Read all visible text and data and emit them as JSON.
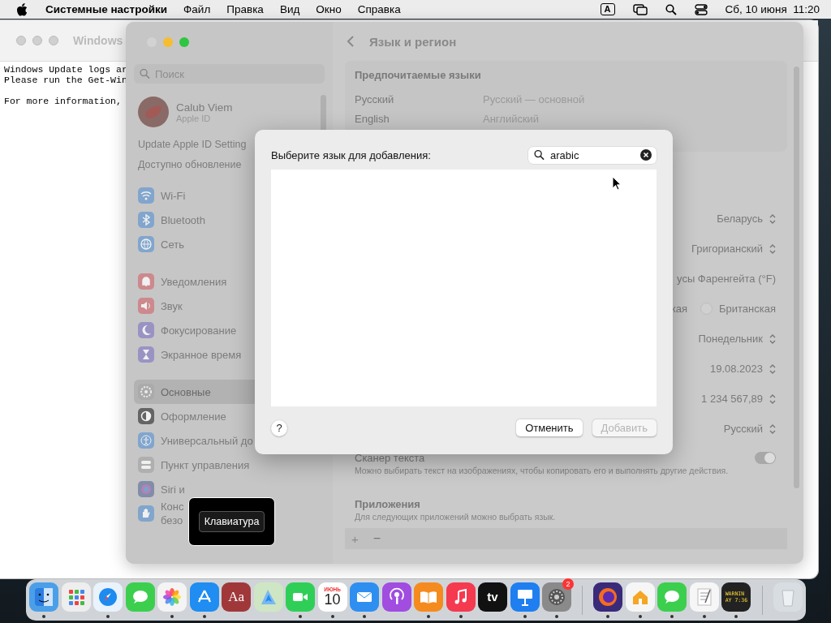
{
  "menu_bar": {
    "app": "Системные настройки",
    "menus": [
      "Файл",
      "Правка",
      "Вид",
      "Окно",
      "Справка"
    ],
    "input_source": "A",
    "clock": "Сб, 10 июня  11:20"
  },
  "terminal": {
    "title": "Windows",
    "paragraphs": [
      [
        "Windows Update logs ar",
        "Please run the Get-Win"
      ],
      [
        "For more information,"
      ]
    ]
  },
  "settings": {
    "title": "Язык и регион",
    "search": {
      "placeholder": "Поиск"
    },
    "account": {
      "name": "Calub Viem",
      "subtitle": "Apple ID"
    },
    "notices": [
      "Update Apple ID Setting",
      "Доступно обновление"
    ],
    "groups": [
      [
        {
          "label": "Wi-Fi",
          "selected": false
        },
        {
          "label": "Bluetooth",
          "selected": false
        },
        {
          "label": "Сеть",
          "selected": false
        }
      ],
      [
        {
          "label": "Уведомления",
          "selected": false
        },
        {
          "label": "Звук",
          "selected": false
        },
        {
          "label": "Фокусирование",
          "selected": false
        },
        {
          "label": "Экранное время",
          "selected": false
        }
      ],
      [
        {
          "label": "Основные",
          "selected": true
        },
        {
          "label": "Оформление",
          "selected": false
        },
        {
          "label": "Универсальный до",
          "selected": false
        },
        {
          "label": "Пункт управления",
          "selected": false
        },
        {
          "label": "Siri и",
          "selected": false
        },
        {
          "label": "Конс",
          "label_2": "безо",
          "selected": false
        }
      ]
    ],
    "preferred": {
      "heading": "Предпочитаемые языки",
      "rows": [
        {
          "name": "Русский",
          "detail": "Русский — основной"
        },
        {
          "name": "English",
          "detail": "Английский"
        }
      ]
    },
    "rows": [
      {
        "kind": "popup",
        "value": "Беларусь"
      },
      {
        "kind": "popup",
        "value": "Григорианский"
      },
      {
        "kind": "text",
        "value": "усы Фаренгейта (°F)"
      },
      {
        "kind": "radio",
        "value": "кая",
        "option": "Британская",
        "selected": false
      },
      {
        "kind": "popup",
        "value": "Понедельник"
      },
      {
        "kind": "popup",
        "value": "19.08.2023"
      },
      {
        "kind": "popup",
        "value": "1 234 567,89"
      },
      {
        "kind": "popup",
        "value": "Русский"
      }
    ],
    "scanner": {
      "title": "Сканер текста",
      "description": "Можно выбирать текст на изображениях, чтобы копировать его и выполнять другие действия.",
      "on": true
    },
    "apps": {
      "title": "Приложения",
      "description": "Для следующих приложений можно выбрать язык.",
      "add": "+",
      "remove": "−"
    }
  },
  "dialog": {
    "prompt": "Выберите язык для добавления:",
    "search": {
      "value": "arabic"
    },
    "help": "?",
    "cancel": "Отменить",
    "add": {
      "label": "Добавить",
      "disabled": true
    }
  },
  "tooltip": {
    "label": "Клавиатура"
  },
  "dock": [
    {
      "running": true
    },
    {
      "running": false
    },
    {
      "running": true
    },
    {
      "running": false
    },
    {
      "running": true
    },
    {
      "running": true
    },
    {
      "running": false,
      "text": "Aa"
    },
    {
      "running": false
    },
    {
      "running": true
    },
    {
      "running": true,
      "month": "ИЮНЬ",
      "day": "10"
    },
    {
      "running": true
    },
    {
      "running": false
    },
    {
      "running": true
    },
    {
      "running": true
    },
    {
      "running": false,
      "text": "tv"
    },
    {
      "running": true
    },
    {
      "running": true,
      "badge": "2"
    },
    {
      "running": true
    },
    {
      "running": true
    },
    {
      "running": true
    },
    {
      "running": true
    },
    {
      "running": true,
      "lines": [
        "WARNIN",
        "AY 7:36"
      ]
    },
    {
      "running": false
    }
  ]
}
